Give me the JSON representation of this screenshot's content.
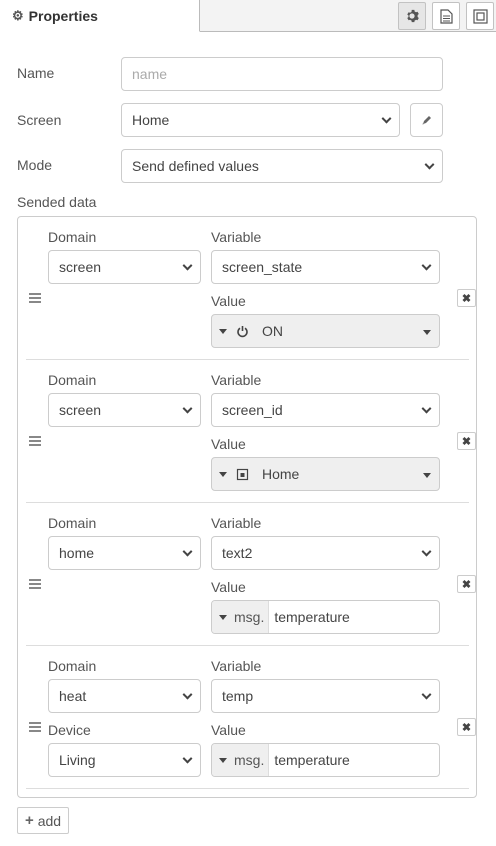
{
  "tabs": {
    "active_label": "Properties",
    "icons": [
      "gear-icon",
      "document-icon",
      "frame-icon"
    ]
  },
  "form": {
    "name_label": "Name",
    "name_placeholder": "name",
    "name_value": "",
    "screen_label": "Screen",
    "screen_value": "Home",
    "mode_label": "Mode",
    "mode_value": "Send defined values",
    "sended_label": "Sended data"
  },
  "rows": [
    {
      "domain_label": "Domain",
      "domain": "screen",
      "variable_label": "Variable",
      "variable": "screen_state",
      "value_label": "Value",
      "value_type": "power-icon",
      "value": "ON"
    },
    {
      "domain_label": "Domain",
      "domain": "screen",
      "variable_label": "Variable",
      "variable": "screen_id",
      "value_label": "Value",
      "value_type": "screen-icon",
      "value": "Home"
    },
    {
      "domain_label": "Domain",
      "domain": "home",
      "variable_label": "Variable",
      "variable": "text2",
      "value_label": "Value",
      "value_prefix": "msg.",
      "value": "temperature"
    },
    {
      "domain_label": "Domain",
      "domain": "heat",
      "variable_label": "Variable",
      "variable": "temp",
      "device_label": "Device",
      "device": "Living",
      "value_label": "Value",
      "value_prefix": "msg.",
      "value": "temperature"
    }
  ],
  "add_label": "add",
  "colors": {
    "border": "#cccccc",
    "tabbar": "#f3f3f3",
    "typed_bg": "#efefef"
  }
}
